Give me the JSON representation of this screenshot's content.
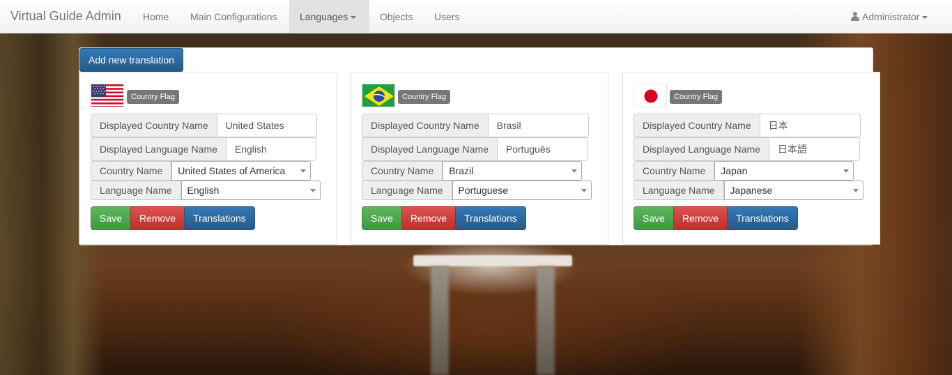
{
  "navbar": {
    "brand": "Virtual Guide Admin",
    "items": [
      {
        "label": "Home"
      },
      {
        "label": "Main Configurations"
      },
      {
        "label": "Languages"
      },
      {
        "label": "Objects"
      },
      {
        "label": "Users"
      }
    ],
    "active_item": "Languages",
    "user": {
      "label": "Administrator",
      "icon": "user-icon"
    }
  },
  "panel": {
    "add_button": "Add new translation",
    "flag_label": "Country Flag",
    "labels": {
      "displayed_country": "Displayed Country Name",
      "displayed_language": "Displayed Language Name",
      "country": "Country Name",
      "language": "Language Name"
    },
    "buttons": {
      "save": "Save",
      "remove": "Remove",
      "translations": "Translations"
    },
    "colors": {
      "save": "#5cb85c",
      "remove": "#d9534f",
      "translations": "#337ab7"
    },
    "translations": [
      {
        "flag": "us-flag-icon",
        "displayed_country": "United States",
        "displayed_language": "English",
        "country": "United States of America",
        "language": "English"
      },
      {
        "flag": "brazil-flag-icon",
        "displayed_country": "Brasil",
        "displayed_language": "Português",
        "country": "Brazil",
        "language": "Portuguese"
      },
      {
        "flag": "japan-flag-icon",
        "displayed_country": "日本",
        "displayed_language": "日本語",
        "country": "Japan",
        "language": "Japanese"
      }
    ]
  }
}
